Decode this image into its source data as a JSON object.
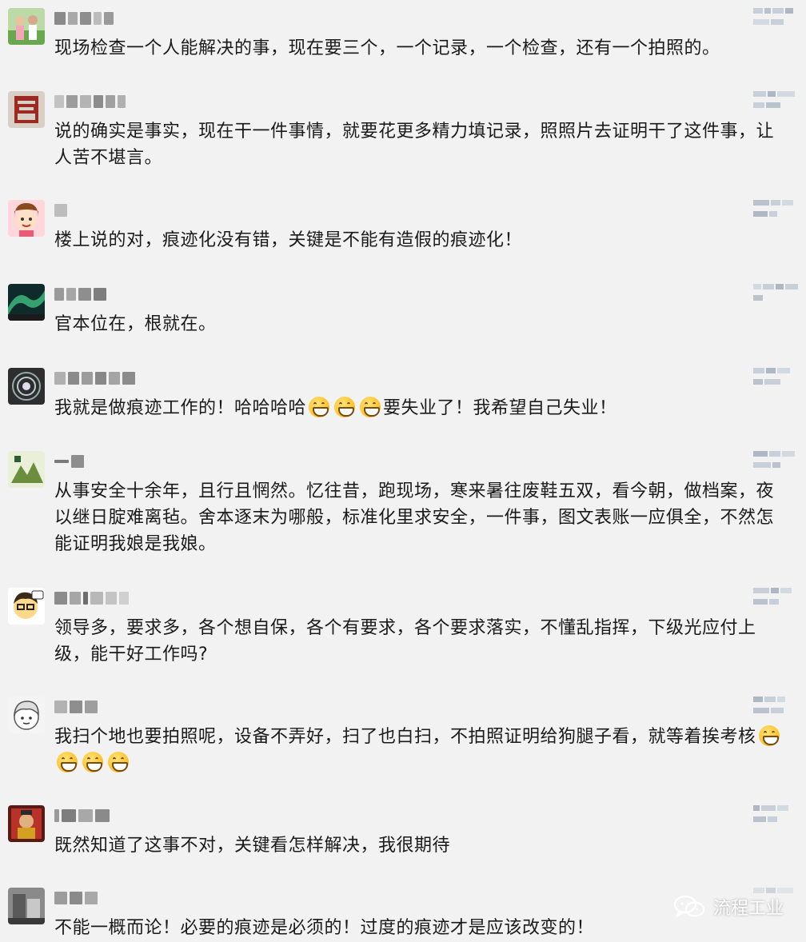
{
  "comments": [
    {
      "text": "现场检查一个人能解决的事，现在要三个，一个记录，一个检查，还有一个拍照的。"
    },
    {
      "text": "说的确实是事实，现在干一件事情，就要花更多精力填记录，照照片去证明干了这件事，让人苦不堪言。"
    },
    {
      "text": "楼上说的对，痕迹化没有错，关键是不能有造假的痕迹化！"
    },
    {
      "text": "官本位在，根就在。"
    },
    {
      "text_before": "我就是做痕迹工作的！哈哈哈哈",
      "text_after": "要失业了！我希望自己失业！"
    },
    {
      "text": "从事安全十余年，且行且惘然。忆往昔，跑现场，寒来暑往废鞋五双，看今朝，做档案，夜以继日腚难离毡。舍本逐末为哪般，标准化里求安全，一件事，图文表账一应俱全，不然怎能证明我娘是我娘。"
    },
    {
      "text": "领导多，要求多，各个想自保，各个有要求，各个要求落实，不懂乱指挥，下级光应付上级，能干好工作吗?"
    },
    {
      "text": "我扫个地也要拍照呢，设备不弄好，扫了也白扫，不拍照证明给狗腿子看，就等着挨考核"
    },
    {
      "text": "既然知道了这事不对，关键看怎样解决，我很期待"
    },
    {
      "text": "不能一概而论！必要的痕迹是必须的！过度的痕迹才是应该改变的！"
    }
  ],
  "watermark": {
    "text": "流程工业"
  },
  "icons": {
    "emoji": "grinning-face-emoji",
    "like": "like-count-pixelated"
  }
}
